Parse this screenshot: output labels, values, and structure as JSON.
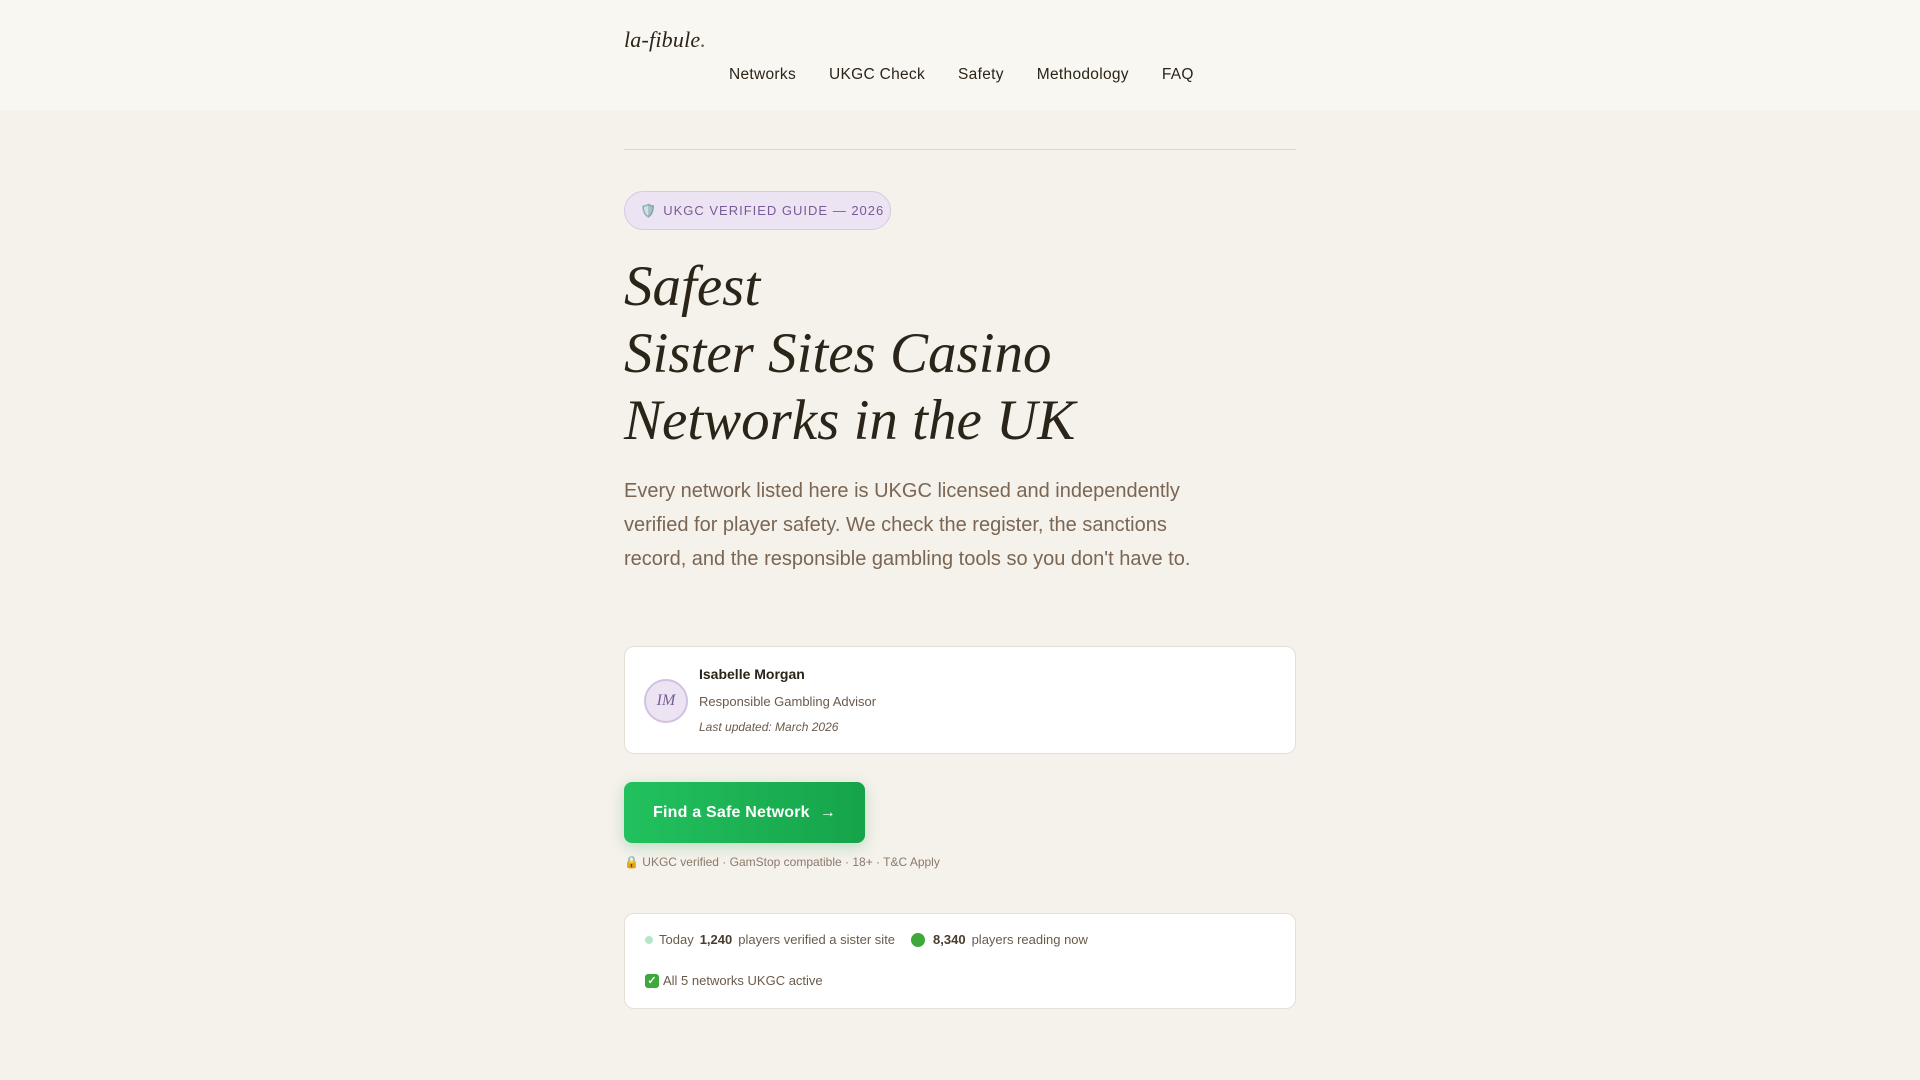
{
  "header": {
    "logo": "la-fibule",
    "logo_dot": ".",
    "nav": [
      "Networks",
      "UKGC Check",
      "Safety",
      "Methodology",
      "FAQ"
    ]
  },
  "hero": {
    "badge_icon": "shield-icon",
    "badge": "UKGC VERIFIED GUIDE — 2026",
    "title_lines": [
      "Safest",
      "Sister Sites Casino",
      "Networks in the UK"
    ],
    "lead": "Every network listed here is UKGC licensed and independently verified for player safety. We check the register, the sanctions record, and the responsible gambling tools so you don't have to."
  },
  "author": {
    "initials": "IM",
    "name": "Isabelle Morgan",
    "role": "Responsible Gambling Advisor",
    "updated": "Last updated: March 2026"
  },
  "cta": {
    "label": "Find a Safe Network",
    "arrow": "→",
    "note": "🔒 UKGC verified · GamStop compatible · 18+ · T&C Apply"
  },
  "stats": {
    "today_label": "Today",
    "verified_count": "1,240",
    "verified_text": "players verified a sister site",
    "reading_count": "8,340",
    "reading_text": "players reading now",
    "networks_text": "All 5 networks UKGC active"
  },
  "colors": {
    "background": "#f5f1eb",
    "accent_purple": "#7a5a98",
    "cta_green": "#16a34a"
  }
}
